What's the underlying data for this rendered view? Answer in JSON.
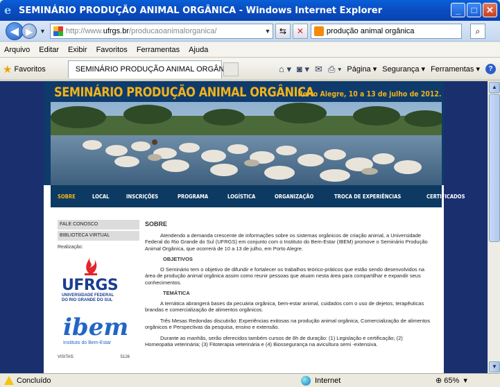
{
  "window": {
    "title": "SEMINÁRIO PRODUÇÃO ANIMAL ORGÂNICA - Windows Internet Explorer",
    "minimize": "_",
    "maximize": "□",
    "close": "✕"
  },
  "address": {
    "url_prefix": "http://www.",
    "url_domain": "ufrgs.br",
    "url_path": "/producaoanimalorganica/",
    "search_value": "produção animal orgânica"
  },
  "menu": [
    "Arquivo",
    "Editar",
    "Exibir",
    "Favoritos",
    "Ferramentas",
    "Ajuda"
  ],
  "commandbar": {
    "favorites": "Favoritos",
    "tab_title": "SEMINÁRIO PRODUÇÃO ANIMAL ORGÂNICA",
    "page": "Página ▾",
    "security": "Segurança ▾",
    "tools": "Ferramentas ▾"
  },
  "site": {
    "title": "SEMINÁRIO PRODUÇÃO ANIMAL ORGÂNICA",
    "date": "Porto Alegre, 10 a 13 de julho de 2012.",
    "nav": [
      "SOBRE",
      "LOCAL",
      "INSCRIÇÕES",
      "PROGRAMA",
      "LOGÍSTICA",
      "ORGANIZAÇÃO",
      "TROCA DE EXPERIÊNCIAS",
      "CERTIFICADOS"
    ],
    "sidebar_links": [
      "FALE CONOSCO",
      "BIBLIOTECA VIRTUAL"
    ],
    "realizacao": "Realização:",
    "ufrgs_word": "UFRGS",
    "ufrgs_sub1": "UNIVERSIDADE FEDERAL",
    "ufrgs_sub2": "DO RIO GRANDE DO SUL",
    "ibem_word": "ibem",
    "ibem_sub": "Instituto do Bem-Estar",
    "visitas_label": "VISITAS:",
    "visitas_count": "5126"
  },
  "content": {
    "heading": "SOBRE",
    "p1": "Atendendo a demanda crescente de informações sobre os sistemas orgânicos de criação animal, a Universidade Federal do Rio Grande do Sul (UFRGS) em conjunto com o Instituto do Bem-Estar (IBEM) promove o Seminário Produção Animal Orgânica, que ocorrerá de 10 a 13 de julho, em Porto Alegre.",
    "objetivos": "OBJETIVOS",
    "p2": "O Seminário tem o objetivo de difundir e fortalecer os trabalhos teórico-práticos que estão sendo desenvolvidos na área de produção animal orgânica assim como reunir pessoas que atuam nesta área para compartilhar e expandir seus conhecimentos.",
    "tematica": "TEMÁTICA",
    "p3": "A temática abrangerá bases da pecuária orgânica, bem-estar animal, cuidados com o uso de dejetos, terapêuticas brandas e comercialização de alimentos orgânicos.",
    "p4": "Três Mesas Redondas discutirão: Experiências exitosas na produção animal orgânica, Comercialização de alimentos orgânicos e Perspectivas da pesquisa, ensino e extensão.",
    "p5": "Durante as manhãs, serão oferecidos também cursos de 8h de duração: (1) Legislação e certificação; (2) Homeopatia veterinária; (3) Fitoterapia veterinária e (4) Biossegurança na avicultura semi -extensiva."
  },
  "status": {
    "text": "Concluído",
    "zone": "Internet",
    "zoom": "65%"
  },
  "colors": {
    "site_accent": "#f2b21b",
    "site_header_bg": "#0e3b6b",
    "page_bg": "#1a2f6e",
    "ufrgs_blue": "#1b3e8f"
  }
}
